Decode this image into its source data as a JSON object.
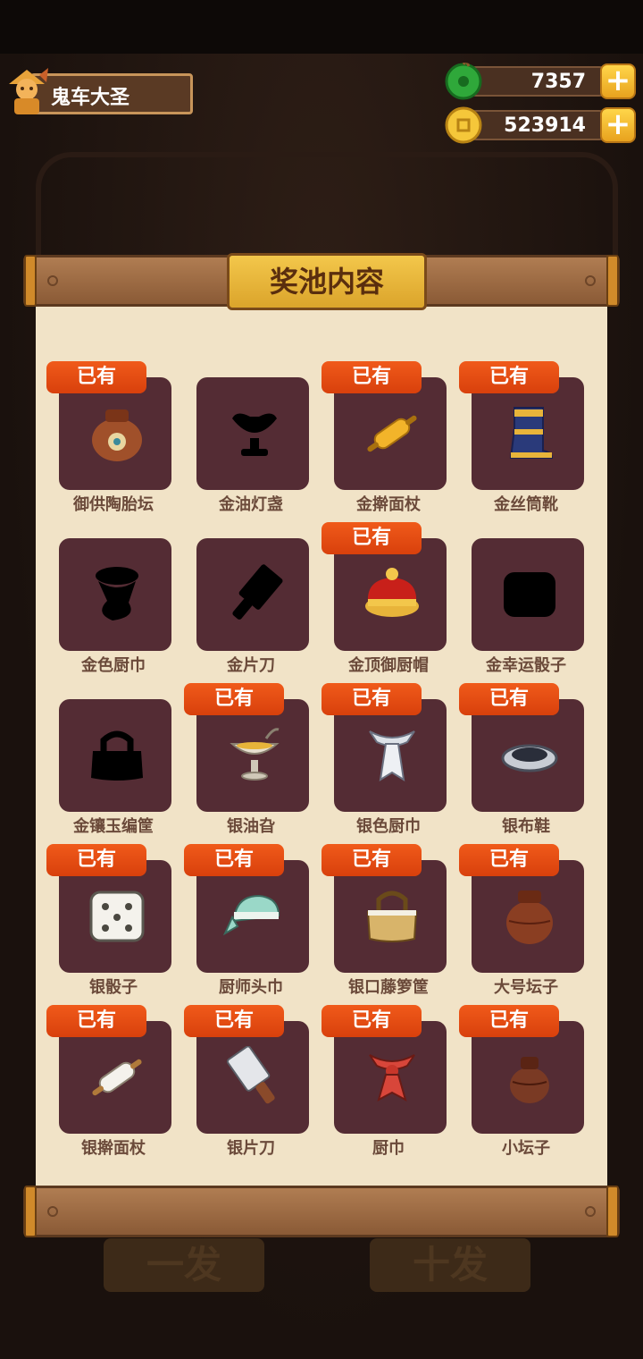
{
  "player": {
    "name": "鬼车大圣",
    "avatar_icon": "chef-character-avatar-icon"
  },
  "currencies": [
    {
      "icon": "jade-coin-icon",
      "value": "7357",
      "plus": "+"
    },
    {
      "icon": "gold-coin-icon",
      "value": "523914",
      "plus": "+"
    }
  ],
  "panel": {
    "title": "奖池内容"
  },
  "background": {
    "single_draw": "一发",
    "ten_draw": "十发"
  },
  "owned_label": "已有",
  "items": [
    {
      "name": "御供陶胎坛",
      "owned": true,
      "icon": "clay-jar-icon"
    },
    {
      "name": "金油灯盏",
      "owned": false,
      "icon": "oil-lamp-silhouette-icon"
    },
    {
      "name": "金擀面杖",
      "owned": true,
      "icon": "gold-rolling-pin-icon"
    },
    {
      "name": "金丝筒靴",
      "owned": true,
      "icon": "gold-boot-icon"
    },
    {
      "name": "金色厨巾",
      "owned": false,
      "icon": "kitchen-towel-silhouette-icon"
    },
    {
      "name": "金片刀",
      "owned": false,
      "icon": "cleaver-silhouette-icon"
    },
    {
      "name": "金顶御厨帽",
      "owned": true,
      "icon": "imperial-chef-hat-icon"
    },
    {
      "name": "金幸运骰子",
      "owned": false,
      "icon": "dice-silhouette-icon"
    },
    {
      "name": "金镶玉编筐",
      "owned": false,
      "icon": "basket-silhouette-icon"
    },
    {
      "name": "银油旮",
      "owned": true,
      "icon": "silver-oil-cup-icon"
    },
    {
      "name": "银色厨巾",
      "owned": true,
      "icon": "silver-neckerchief-icon"
    },
    {
      "name": "银布鞋",
      "owned": true,
      "icon": "silver-cloth-shoe-icon"
    },
    {
      "name": "银骰子",
      "owned": true,
      "icon": "silver-dice-icon"
    },
    {
      "name": "厨师头巾",
      "owned": true,
      "icon": "chef-headscarf-icon"
    },
    {
      "name": "银口藤箩筐",
      "owned": true,
      "icon": "rattan-basket-icon"
    },
    {
      "name": "大号坛子",
      "owned": true,
      "icon": "large-jar-icon"
    },
    {
      "name": "银擀面杖",
      "owned": true,
      "icon": "silver-rolling-pin-icon"
    },
    {
      "name": "银片刀",
      "owned": true,
      "icon": "silver-cleaver-icon"
    },
    {
      "name": "厨巾",
      "owned": true,
      "icon": "red-neckerchief-icon"
    },
    {
      "name": "小坛子",
      "owned": true,
      "icon": "small-jar-icon"
    }
  ]
}
